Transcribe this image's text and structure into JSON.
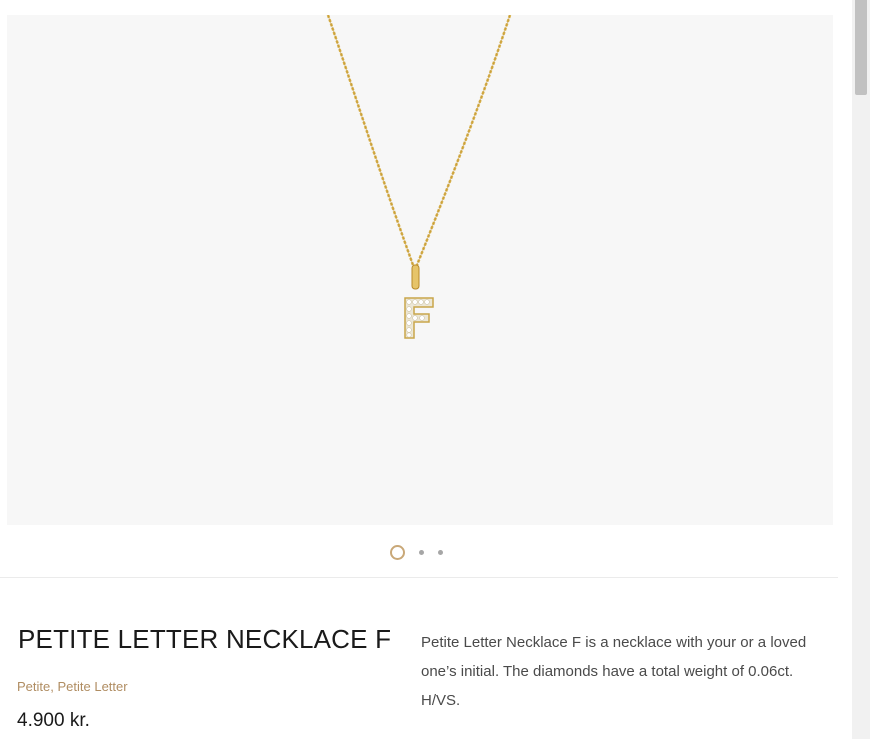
{
  "gallery": {
    "slide_count": 3,
    "active_index": 0,
    "colors": {
      "background": "#f7f7f7",
      "gold": "#d9b24c",
      "active_dot": "#c9a878",
      "dot": "#a6a6a6"
    }
  },
  "product": {
    "title": "PETITE LETTER NECKLACE F",
    "categories": [
      "Petite",
      "Petite Letter"
    ],
    "category_separator": ", ",
    "price": "4.900 kr.",
    "description": "Petite Letter Necklace F is a necklace with your or a loved one’s initial. The diamonds have a total weight of 0.06ct. H/VS.",
    "pendant_letter": "F"
  },
  "icons": [
    "carousel-dot-icon"
  ]
}
